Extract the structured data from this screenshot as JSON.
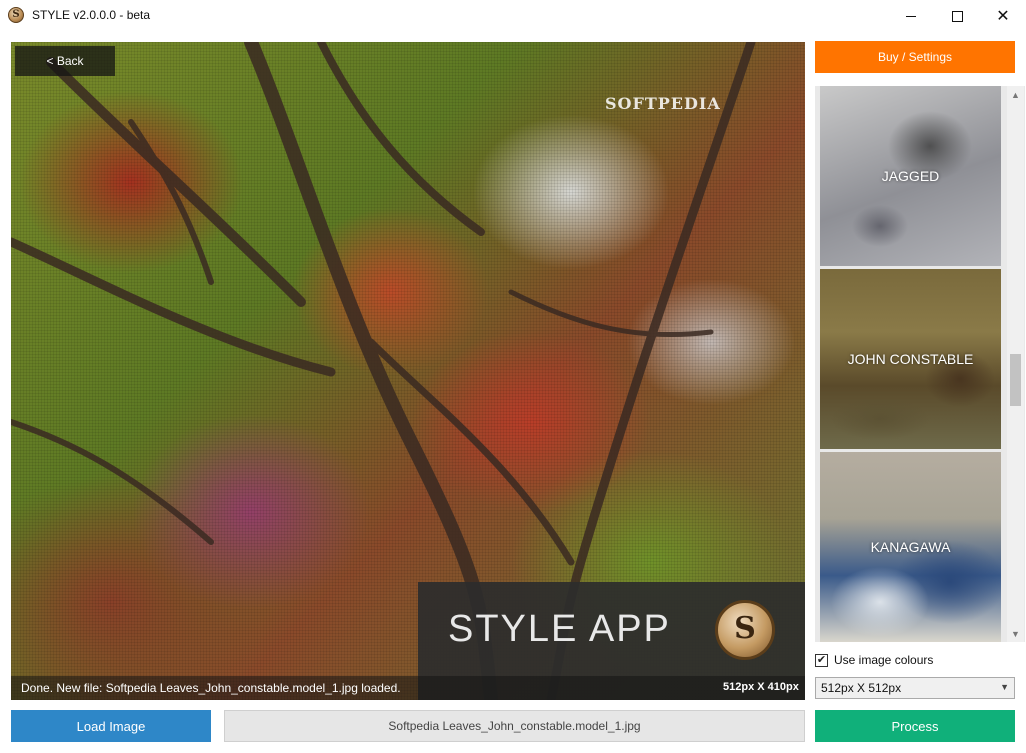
{
  "window": {
    "title": "STYLE v2.0.0.0 - beta",
    "icon_letter": "S",
    "minimize_icon": "minimize-icon",
    "maximize_icon": "maximize-icon",
    "close_glyph": "✕"
  },
  "canvas": {
    "back_label": "< Back",
    "watermark": "SOFTPEDIA",
    "brand_text": "STYLE APP",
    "brand_logo_letter": "S",
    "status_text": "Done. New file: Softpedia Leaves_John_constable.model_1.jpg loaded.",
    "dimensions_text": "512px X 410px"
  },
  "sidebar": {
    "buy_label": "Buy / Settings",
    "styles": [
      {
        "label": "JAGGED"
      },
      {
        "label": "JOHN CONSTABLE"
      },
      {
        "label": "KANAGAWA"
      }
    ],
    "use_colours_label": "Use image colours",
    "use_colours_checked": true,
    "check_glyph": "✔",
    "size_selected": "512px X 512px"
  },
  "bottom": {
    "load_label": "Load Image",
    "filename": "Softpedia Leaves_John_constable.model_1.jpg",
    "process_label": "Process"
  },
  "colors": {
    "buy": "#ff7400",
    "load": "#2e87c8",
    "process": "#10b07a"
  }
}
